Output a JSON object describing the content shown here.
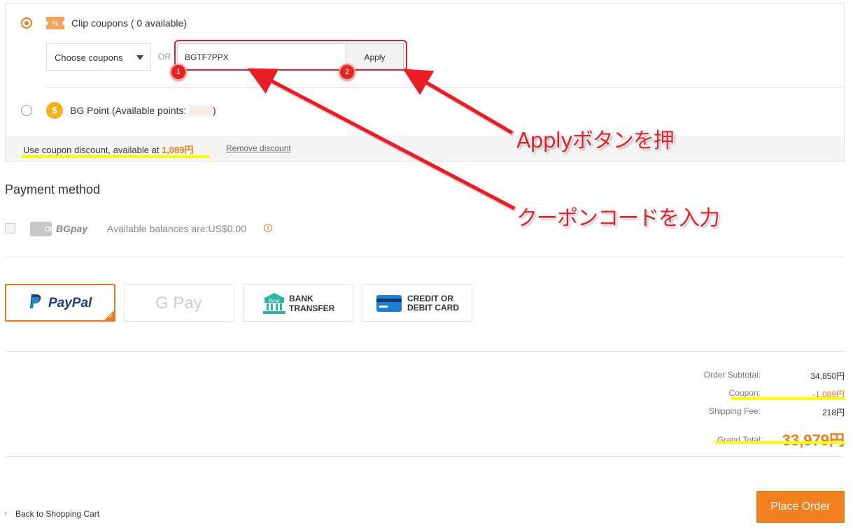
{
  "coupons": {
    "clip_label": "Clip coupons ( 0 available)",
    "choose_label": "Choose coupons",
    "or_label": "OR",
    "code_value": "BGTF7PPX",
    "apply_label": "Apply",
    "badge1": "1",
    "badge2": "2",
    "bg_point_label": "BG Point (Available points:",
    "bg_point_close": ")",
    "discount_prefix": "Use coupon discount, available at ",
    "discount_amount": "1,089円",
    "remove_label": "Remove discount"
  },
  "annotations": {
    "apply_note": "Applyボタンを押",
    "code_note": "クーポンコードを入力"
  },
  "payment": {
    "title": "Payment method",
    "bgpay_label": "BGpay",
    "balance_text": "Available balances are:US$0.00",
    "options": [
      {
        "name": "PayPal",
        "selected": true
      },
      {
        "name": "G Pay",
        "selected": false
      },
      {
        "name": "BANK TRANSFER",
        "line1": "BANK",
        "line2": "TRANSFER",
        "icon_text": "Bank",
        "selected": false
      },
      {
        "name": "CREDIT OR DEBIT CARD",
        "line1": "CREDIT OR",
        "line2": "DEBIT CARD",
        "selected": false
      }
    ]
  },
  "summary": {
    "subtotal_label": "Order Subtotal:",
    "subtotal_value": "34,850円",
    "coupon_label": "Coupon:",
    "coupon_value": "-1,089円",
    "shipping_label": "Shipping Fee:",
    "shipping_value": "218円",
    "grand_label": "Grand Total:",
    "grand_value": "33,979円"
  },
  "footer": {
    "back_label": "Back to Shopping Cart",
    "place_order_label": "Place Order"
  },
  "colors": {
    "accent": "#ef7b1f",
    "annotation_red": "#ec1c24",
    "highlight": "#ffff00"
  }
}
